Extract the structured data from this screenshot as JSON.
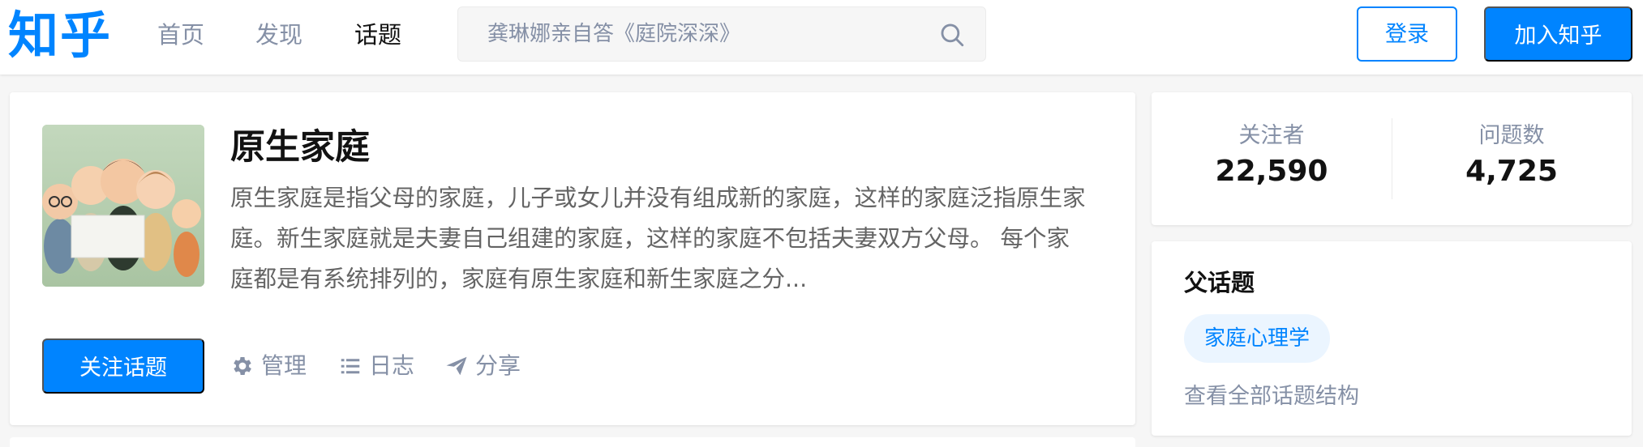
{
  "header": {
    "logo": "知乎",
    "nav": [
      {
        "label": "首页",
        "active": false
      },
      {
        "label": "发现",
        "active": false
      },
      {
        "label": "话题",
        "active": true
      }
    ],
    "search": {
      "placeholder": "龚琳娜亲自答《庭院深深》",
      "icon": "search-icon"
    },
    "login_label": "登录",
    "join_label": "加入知乎"
  },
  "topic": {
    "image_icon": "family-figurines-image",
    "title": "原生家庭",
    "description": "原生家庭是指父母的家庭，儿子或女儿并没有组成新的家庭，这样的家庭泛指原生家庭。新生家庭就是夫妻自己组建的家庭，这样的家庭不包括夫妻双方父母。 每个家庭都是有系统排列的，家庭有原生家庭和新生家庭之分...",
    "follow_label": "关注话题",
    "actions": [
      {
        "label": "管理",
        "icon": "gear-icon"
      },
      {
        "label": "日志",
        "icon": "list-icon"
      },
      {
        "label": "分享",
        "icon": "paper-plane-icon"
      }
    ]
  },
  "stats": {
    "followers_label": "关注者",
    "followers_value": "22,590",
    "questions_label": "问题数",
    "questions_value": "4,725"
  },
  "parent_topics": {
    "title": "父话题",
    "tags": [
      "家庭心理学"
    ],
    "view_all_label": "查看全部话题结构"
  },
  "colors": {
    "brand": "#0084ff",
    "text_primary": "#121212",
    "text_secondary": "#8590a6",
    "text_body": "#646464",
    "page_bg": "#f6f6f6",
    "tag_bg": "#ebf5ff"
  }
}
